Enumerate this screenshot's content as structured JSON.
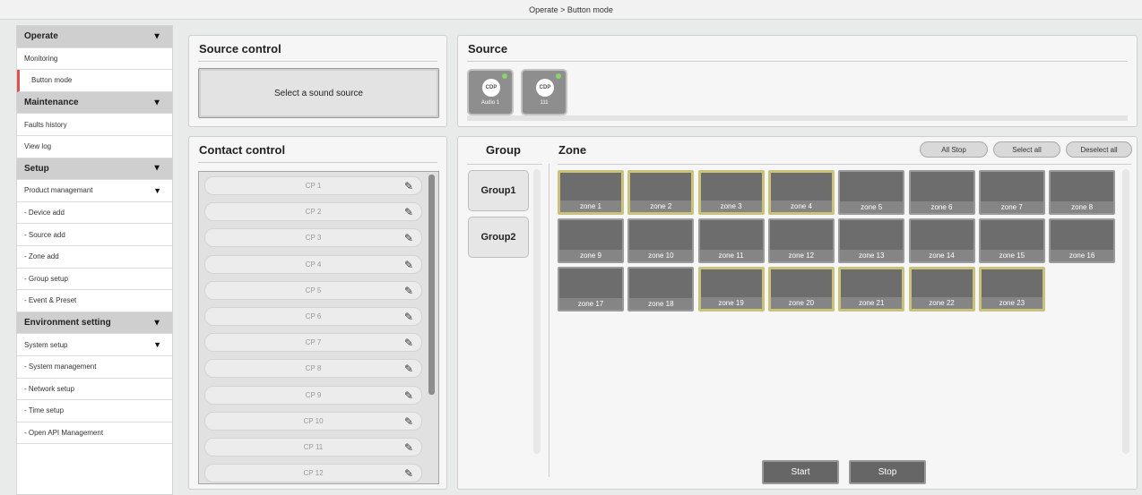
{
  "breadcrumb": "Operate > Button mode",
  "sidebar": {
    "rows": [
      {
        "label": "Operate",
        "type": "head",
        "arrow": "▼"
      },
      {
        "label": "Monitoring",
        "type": "item"
      },
      {
        "label": "Button mode",
        "type": "item",
        "active": true
      },
      {
        "label": "Maintenance",
        "type": "head",
        "arrow": "▼"
      },
      {
        "label": "Faults history",
        "type": "item"
      },
      {
        "label": "View log",
        "type": "item"
      },
      {
        "label": "Setup",
        "type": "head",
        "arrow": "▼"
      },
      {
        "label": "Product managemant",
        "type": "item",
        "arrow": "▼"
      },
      {
        "label": "- Device add",
        "type": "item"
      },
      {
        "label": "- Source add",
        "type": "item"
      },
      {
        "label": "- Zone add",
        "type": "item"
      },
      {
        "label": "- Group setup",
        "type": "item"
      },
      {
        "label": "- Event & Preset",
        "type": "item"
      },
      {
        "label": "Environment setting",
        "type": "head",
        "arrow": "▼"
      },
      {
        "label": "System setup",
        "type": "item",
        "arrow": "▼"
      },
      {
        "label": "- System management",
        "type": "item"
      },
      {
        "label": "- Network setup",
        "type": "item"
      },
      {
        "label": "- Time setup",
        "type": "item"
      },
      {
        "label": "- Open API Management",
        "type": "item"
      }
    ]
  },
  "source_control": {
    "title": "Source control",
    "select_button": "Select a sound source"
  },
  "source": {
    "title": "Source",
    "tiles": [
      {
        "badge": "CDP",
        "label": "Audio 1"
      },
      {
        "badge": "CDP",
        "label": "111"
      }
    ]
  },
  "contact_control": {
    "title": "Contact control",
    "items": [
      "CP 1",
      "CP 2",
      "CP 3",
      "CP 4",
      "CP 5",
      "CP 6",
      "CP 7",
      "CP 8",
      "CP 9",
      "CP 10",
      "CP 11",
      "CP 12"
    ]
  },
  "group": {
    "title": "Group",
    "items": [
      "Group1",
      "Group2"
    ]
  },
  "zone": {
    "title": "Zone",
    "buttons": {
      "all_stop": "All Stop",
      "select_all": "Select all",
      "deselect_all": "Deselect all"
    },
    "items": [
      {
        "label": "zone 1",
        "selected": true
      },
      {
        "label": "zone 2",
        "selected": true
      },
      {
        "label": "zone 3",
        "selected": true
      },
      {
        "label": "zone 4",
        "selected": true
      },
      {
        "label": "zone 5",
        "selected": false
      },
      {
        "label": "zone 6",
        "selected": false
      },
      {
        "label": "zone 7",
        "selected": false
      },
      {
        "label": "zone 8",
        "selected": false
      },
      {
        "label": "zone 9",
        "selected": false
      },
      {
        "label": "zone 10",
        "selected": false
      },
      {
        "label": "zone 11",
        "selected": false
      },
      {
        "label": "zone 12",
        "selected": false
      },
      {
        "label": "zone 13",
        "selected": false
      },
      {
        "label": "zone 14",
        "selected": false
      },
      {
        "label": "zone 15",
        "selected": false
      },
      {
        "label": "zone 16",
        "selected": false
      },
      {
        "label": "zone 17",
        "selected": false
      },
      {
        "label": "zone 18",
        "selected": false
      },
      {
        "label": "zone 19",
        "selected": true
      },
      {
        "label": "zone 20",
        "selected": true
      },
      {
        "label": "zone 21",
        "selected": true
      },
      {
        "label": "zone 22",
        "selected": true
      },
      {
        "label": "zone 23",
        "selected": true
      }
    ],
    "start_label": "Start",
    "stop_label": "Stop"
  },
  "colors": {
    "active_marker": "#d9534f",
    "zone_selected_border": "#c8c27a",
    "source_online_dot": "#8ad26a"
  },
  "icons": {
    "edit": "pencil-icon",
    "expand": "chevron-down-icon",
    "status": "online-dot-icon"
  }
}
